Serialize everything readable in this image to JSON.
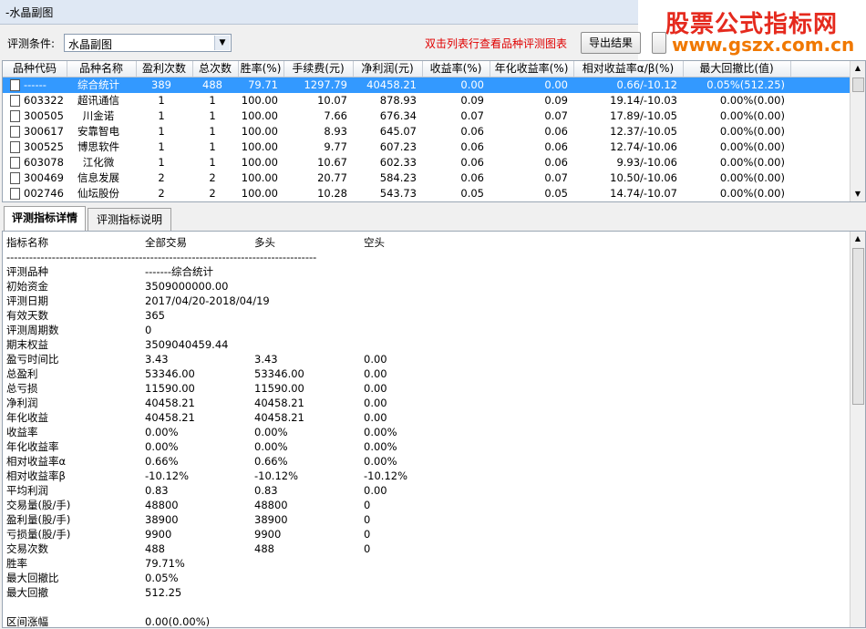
{
  "window": {
    "title": "-水晶副图"
  },
  "watermark": {
    "line1": "股票公式指标网",
    "line2": "www.gszx.com.cn"
  },
  "toolbar": {
    "condition_label": "评测条件:",
    "condition_value": "水晶副图",
    "hint": "双击列表行查看品种评测图表",
    "export_label": "导出结果"
  },
  "grid": {
    "headers": [
      "品种代码",
      "品种名称",
      "盈利次数",
      "总次数",
      "胜率(%)",
      "手续费(元)",
      "净利润(元)",
      "收益率(%)",
      "年化收益率(%)",
      "相对收益率α/β(%)",
      "最大回撤比(值)"
    ],
    "rows": [
      [
        "------",
        "综合统计",
        "389",
        "488",
        "79.71",
        "1297.79",
        "40458.21",
        "0.00",
        "0.00",
        "0.66/-10.12",
        "0.05%(512.25)"
      ],
      [
        "603322",
        "超讯通信",
        "1",
        "1",
        "100.00",
        "10.07",
        "878.93",
        "0.09",
        "0.09",
        "19.14/-10.03",
        "0.00%(0.00)"
      ],
      [
        "300505",
        "川金诺",
        "1",
        "1",
        "100.00",
        "7.66",
        "676.34",
        "0.07",
        "0.07",
        "17.89/-10.05",
        "0.00%(0.00)"
      ],
      [
        "300617",
        "安靠智电",
        "1",
        "1",
        "100.00",
        "8.93",
        "645.07",
        "0.06",
        "0.06",
        "12.37/-10.05",
        "0.00%(0.00)"
      ],
      [
        "300525",
        "博思软件",
        "1",
        "1",
        "100.00",
        "9.77",
        "607.23",
        "0.06",
        "0.06",
        "12.74/-10.06",
        "0.00%(0.00)"
      ],
      [
        "603078",
        "江化微",
        "1",
        "1",
        "100.00",
        "10.67",
        "602.33",
        "0.06",
        "0.06",
        "9.93/-10.06",
        "0.00%(0.00)"
      ],
      [
        "300469",
        "信息发展",
        "2",
        "2",
        "100.00",
        "20.77",
        "584.23",
        "0.06",
        "0.07",
        "10.50/-10.06",
        "0.00%(0.00)"
      ],
      [
        "002746",
        "仙坛股份",
        "2",
        "2",
        "100.00",
        "10.28",
        "543.73",
        "0.05",
        "0.05",
        "14.74/-10.07",
        "0.00%(0.00)"
      ]
    ]
  },
  "tabs": [
    {
      "label": "评测指标详情",
      "active": true
    },
    {
      "label": "评测指标说明",
      "active": false
    }
  ],
  "detail": {
    "header": [
      "指标名称",
      "全部交易",
      "多头",
      "空头"
    ],
    "separator": "----------------------------------------------------------------------------------",
    "rows": [
      [
        "评测品种",
        "-------综合统计",
        "",
        ""
      ],
      [
        "初始资金",
        "3509000000.00",
        "",
        ""
      ],
      [
        "评测日期",
        "2017/04/20-2018/04/19",
        "",
        ""
      ],
      [
        "有效天数",
        "365",
        "",
        ""
      ],
      [
        "评测周期数",
        "0",
        "",
        ""
      ],
      [
        "期末权益",
        "3509040459.44",
        "",
        ""
      ],
      [
        "盈亏时间比",
        "3.43",
        "3.43",
        "0.00"
      ],
      [
        "总盈利",
        "53346.00",
        "53346.00",
        "0.00"
      ],
      [
        "总亏损",
        "11590.00",
        "11590.00",
        "0.00"
      ],
      [
        "净利润",
        "40458.21",
        "40458.21",
        "0.00"
      ],
      [
        "年化收益",
        "40458.21",
        "40458.21",
        "0.00"
      ],
      [
        "收益率",
        "0.00%",
        "0.00%",
        "0.00%"
      ],
      [
        "年化收益率",
        "0.00%",
        "0.00%",
        "0.00%"
      ],
      [
        "相对收益率α",
        "0.66%",
        "0.66%",
        "0.00%"
      ],
      [
        "相对收益率β",
        "-10.12%",
        "-10.12%",
        "-10.12%"
      ],
      [
        "平均利润",
        "0.83",
        "0.83",
        "0.00"
      ],
      [
        "交易量(股/手)",
        "48800",
        "48800",
        "0"
      ],
      [
        "盈利量(股/手)",
        "38900",
        "38900",
        "0"
      ],
      [
        "亏损量(股/手)",
        "9900",
        "9900",
        "0"
      ],
      [
        "交易次数",
        "488",
        "488",
        "0"
      ],
      [
        "胜率",
        "79.71%",
        "",
        ""
      ],
      [
        "最大回撤比",
        "0.05%",
        "",
        ""
      ],
      [
        "最大回撤",
        "512.25",
        "",
        ""
      ],
      [
        "",
        "",
        "",
        ""
      ],
      [
        "区间涨幅",
        "0.00(0.00%)",
        "",
        ""
      ]
    ]
  }
}
